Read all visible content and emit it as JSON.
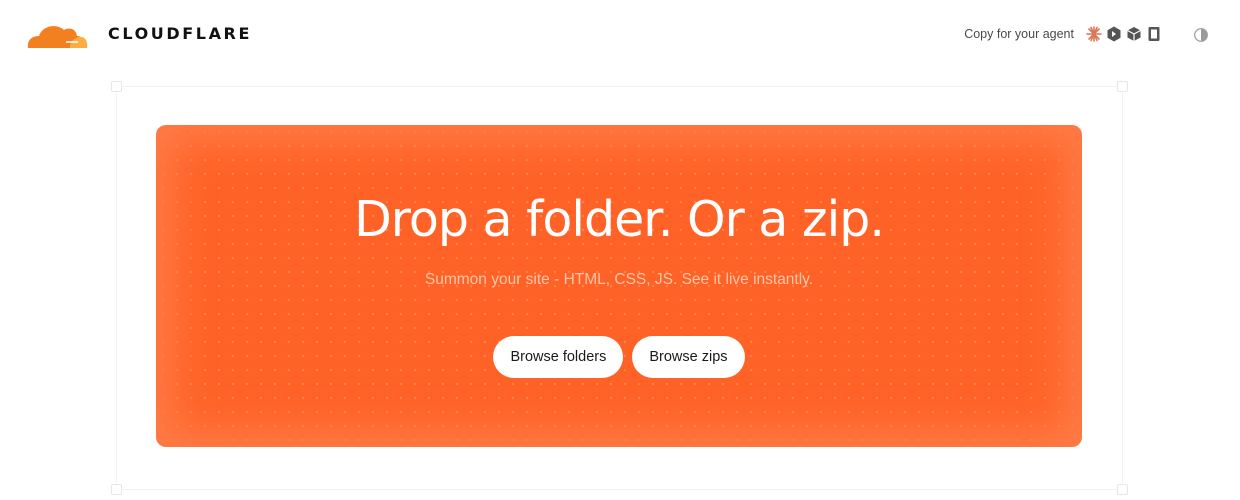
{
  "header": {
    "logo_text": "CLOUDFLARE",
    "agent_label": "Copy for your agent",
    "agent_icons": [
      "claude-icon",
      "cursor-icon",
      "cube-icon",
      "book-icon"
    ],
    "theme_icon": "half-circle-contrast-icon"
  },
  "drop_zone": {
    "headline": "Drop a folder. Or a zip.",
    "subtitle": "Summon your site - HTML, CSS, JS. See it live instantly.",
    "buttons": {
      "browse_folders": "Browse folders",
      "browse_zips": "Browse zips"
    }
  },
  "colors": {
    "brand_orange": "#f38020",
    "drop_zone_orange": "#ff6226",
    "subtitle_tint": "#ffc6a8",
    "button_bg": "#ffffff",
    "text_dark": "#111111"
  }
}
